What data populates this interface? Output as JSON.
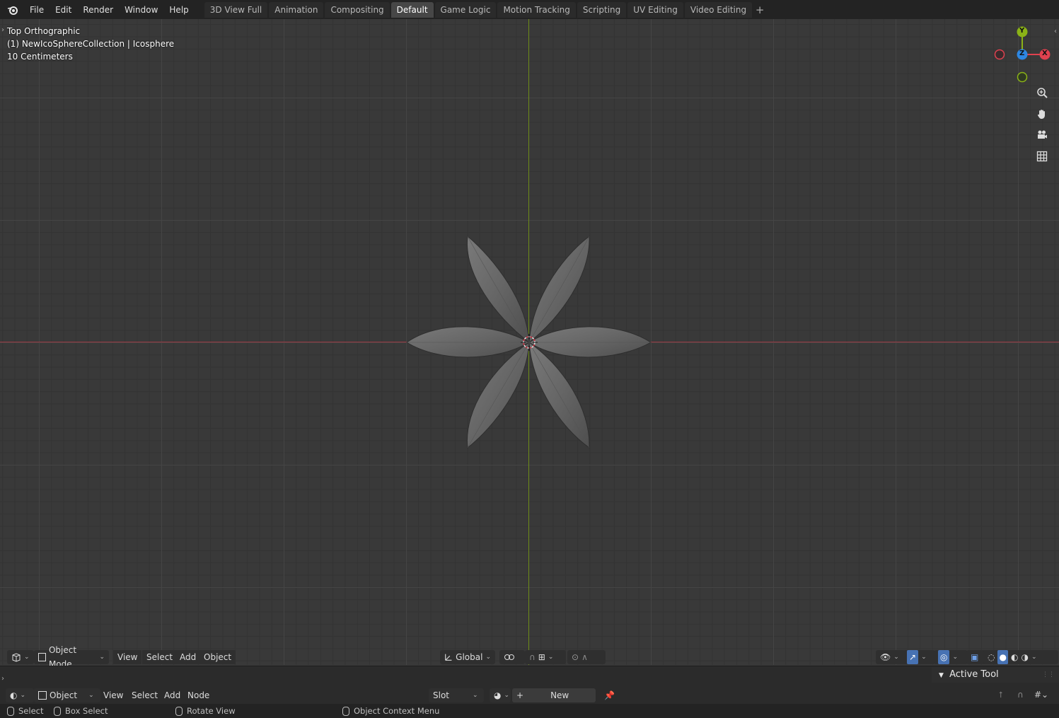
{
  "menubar": {
    "items": [
      "File",
      "Edit",
      "Render",
      "Window",
      "Help"
    ]
  },
  "workspaces": {
    "tabs": [
      "3D View Full",
      "Animation",
      "Compositing",
      "Default",
      "Game Logic",
      "Motion Tracking",
      "Scripting",
      "UV Editing",
      "Video Editing"
    ],
    "active": "Default",
    "add_icon": "+"
  },
  "viewport": {
    "view_name": "Top Orthographic",
    "object_info": "(1) NewIcoSphereCollection | Icosphere",
    "grid_scale": "10 Centimeters",
    "gizmo": {
      "x": "X",
      "y": "Y",
      "z": "Z"
    },
    "colors": {
      "x_axis": "#9b3a44",
      "y_axis": "#6e8c1a",
      "gizmo_x": "#e0414f",
      "gizmo_y": "#8bb317",
      "gizmo_z": "#2d87e3"
    }
  },
  "vp_header": {
    "mode": "Object Mode",
    "view": "View",
    "select": "Select",
    "add": "Add",
    "object": "Object",
    "orientation": "Global"
  },
  "node_header": {
    "editor": "Object",
    "view": "View",
    "select": "Select",
    "add": "Add",
    "node": "Node",
    "slot": "Slot",
    "new": "New"
  },
  "sidebar": {
    "active_tool": "Active Tool"
  },
  "statusbar": {
    "select": "Select",
    "box_select": "Box Select",
    "rotate_view": "Rotate View",
    "context_menu": "Object Context Menu"
  }
}
